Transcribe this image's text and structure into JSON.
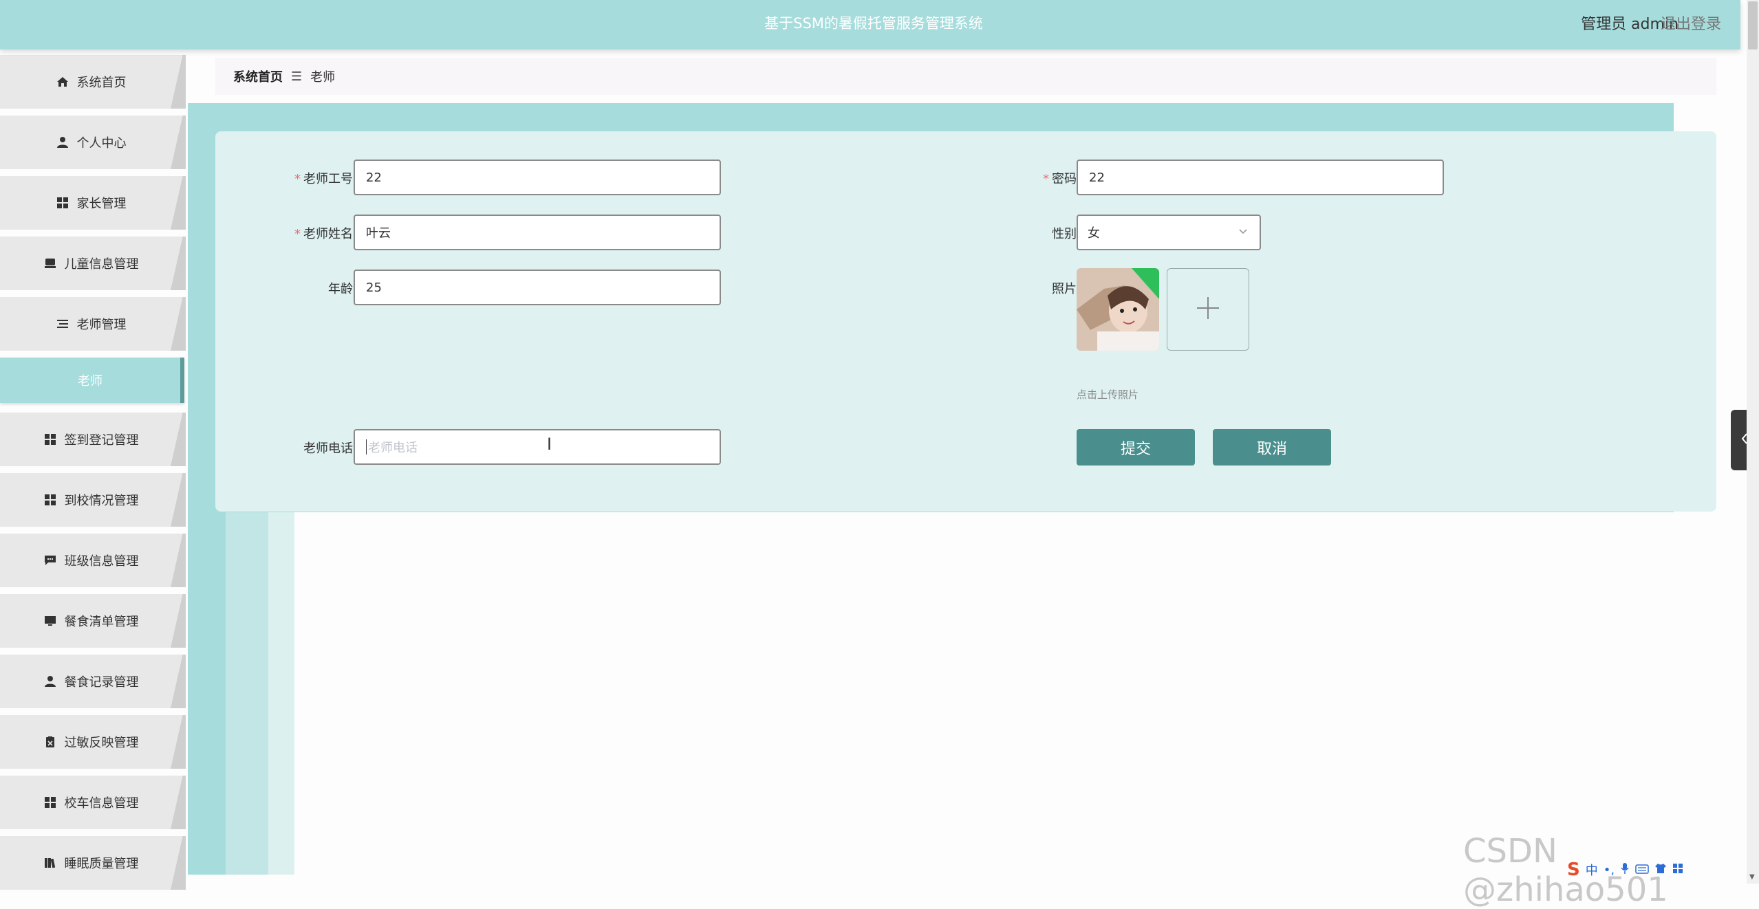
{
  "header": {
    "title": "基于SSM的暑假托管服务管理系统",
    "user": "管理员 admin",
    "logout": "退出登录"
  },
  "sidebar": {
    "items": [
      {
        "label": "系统首页",
        "icon": "home-icon"
      },
      {
        "label": "个人中心",
        "icon": "person-icon"
      },
      {
        "label": "家长管理",
        "icon": "grid-icon"
      },
      {
        "label": "儿童信息管理",
        "icon": "tray-icon"
      },
      {
        "label": "老师管理",
        "icon": "list-icon"
      },
      {
        "label": "签到登记管理",
        "icon": "grid-icon"
      },
      {
        "label": "到校情况管理",
        "icon": "grid-icon"
      },
      {
        "label": "班级信息管理",
        "icon": "chat-icon"
      },
      {
        "label": "餐食清单管理",
        "icon": "monitor-icon"
      },
      {
        "label": "餐食记录管理",
        "icon": "person-icon"
      },
      {
        "label": "过敏反映管理",
        "icon": "clipboard-icon"
      },
      {
        "label": "校车信息管理",
        "icon": "grid-icon"
      },
      {
        "label": "睡眠质量管理",
        "icon": "book-icon"
      }
    ],
    "active_sub": "老师"
  },
  "breadcrumb": {
    "home": "系统首页",
    "separator": "☰",
    "current": "老师"
  },
  "form": {
    "teacher_no": {
      "label": "老师工号",
      "required": true,
      "value": "22"
    },
    "teacher_name": {
      "label": "老师姓名",
      "required": true,
      "value": "叶云"
    },
    "age": {
      "label": "年龄",
      "value": "25"
    },
    "password": {
      "label": "密码",
      "required": true,
      "value": "22"
    },
    "gender": {
      "label": "性别",
      "value": "女"
    },
    "photo": {
      "label": "照片",
      "hint": "点击上传照片"
    },
    "phone": {
      "label": "老师电话",
      "value": "",
      "placeholder": "老师电话"
    },
    "required_mark": "*"
  },
  "buttons": {
    "submit": "提交",
    "cancel": "取消"
  },
  "watermark": "CSDN @zhihao501",
  "ime": {
    "lang": "中",
    "punct": "•,"
  },
  "colors": {
    "header_bg": "#a6dcdc",
    "accent_dark": "#4a8e8e",
    "form_bg": "#dff1f1",
    "required": "#f56c6c"
  }
}
